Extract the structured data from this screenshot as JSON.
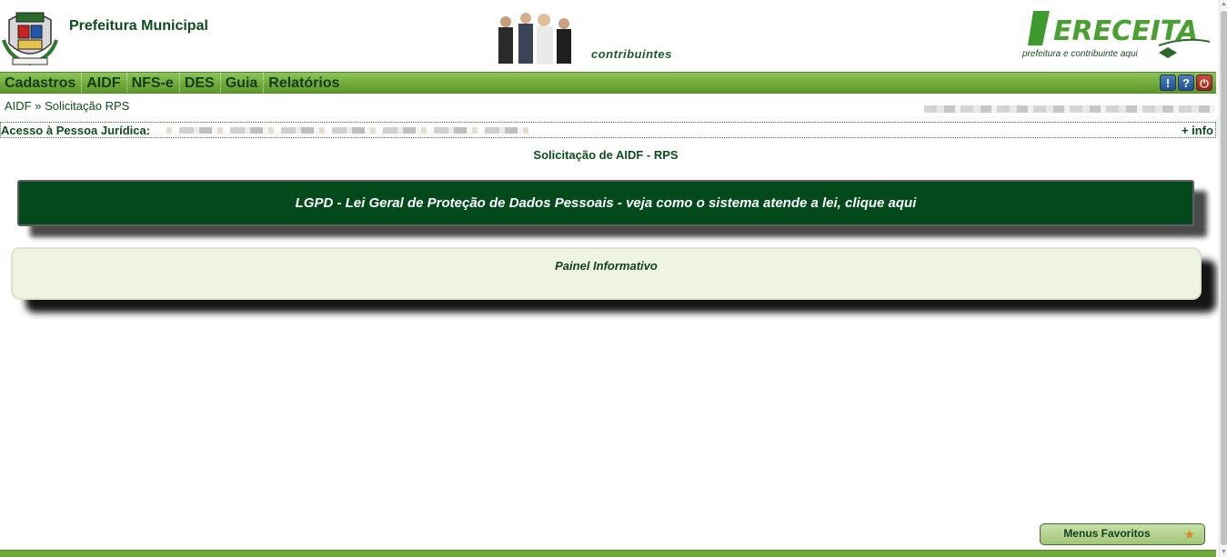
{
  "header": {
    "org_name": "Prefeitura Municipal",
    "tagline": "contribuintes",
    "brand_subtitle": "prefeitura e contribuinte aqui",
    "brand_logo_text": "ERECEITA"
  },
  "menu": {
    "items": [
      {
        "label": "Cadastros"
      },
      {
        "label": "AIDF"
      },
      {
        "label": "NFS-e"
      },
      {
        "label": "DES"
      },
      {
        "label": "Guia"
      },
      {
        "label": "Relatórios"
      }
    ],
    "icons": {
      "info": "!",
      "help": "?",
      "exit": "⏻"
    }
  },
  "breadcrumb": {
    "root": "AIDF",
    "separator": "»",
    "current": "Solicitação RPS"
  },
  "access": {
    "label": "Acesso à Pessoa Jurídica:",
    "more_info": "+ info"
  },
  "section_title": "Solicitação de AIDF - RPS",
  "lgpd_banner": "LGPD - Lei Geral de Proteção de Dados Pessoais - veja como o sistema atende a lei, clique aqui",
  "panel": {
    "title": "Painel Informativo"
  },
  "favorites": {
    "label": "Menus Favoritos",
    "icon": "star-icon"
  },
  "colors": {
    "menu_green": "#6ea83a",
    "banner_green": "#024a1c",
    "text_green": "#0d4d1a",
    "panel_bg": "#eef3e4"
  }
}
